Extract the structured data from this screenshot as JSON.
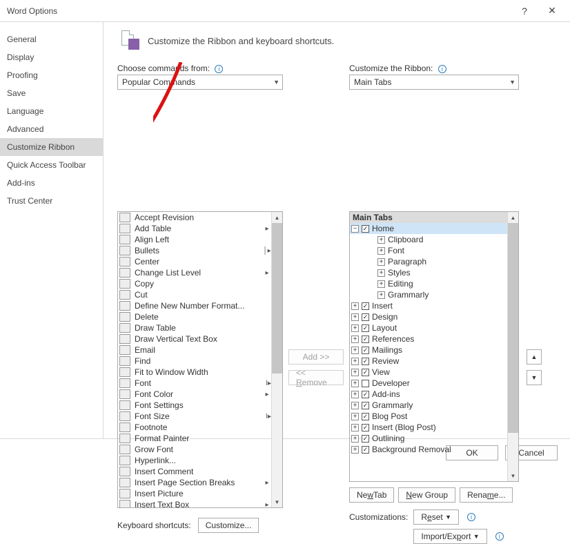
{
  "window": {
    "title": "Word Options"
  },
  "sidebar": {
    "items": [
      "General",
      "Display",
      "Proofing",
      "Save",
      "Language",
      "Advanced",
      "Customize Ribbon",
      "Quick Access Toolbar",
      "Add-ins",
      "Trust Center"
    ],
    "selected_index": 6
  },
  "heading": "Customize the Ribbon and keyboard shortcuts.",
  "choose_label": "Choose commands from:",
  "choose_value": "Popular Commands",
  "customize_label": "Customize the Ribbon:",
  "customize_value": "Main Tabs",
  "commands": [
    {
      "label": "Accept Revision"
    },
    {
      "label": "Add Table",
      "sub": true
    },
    {
      "label": "Align Left"
    },
    {
      "label": "Bullets",
      "sub": true,
      "split": true
    },
    {
      "label": "Center"
    },
    {
      "label": "Change List Level",
      "sub": true
    },
    {
      "label": "Copy"
    },
    {
      "label": "Cut"
    },
    {
      "label": "Define New Number Format..."
    },
    {
      "label": "Delete"
    },
    {
      "label": "Draw Table"
    },
    {
      "label": "Draw Vertical Text Box"
    },
    {
      "label": "Email"
    },
    {
      "label": "Find"
    },
    {
      "label": "Fit to Window Width"
    },
    {
      "label": "Font",
      "split": true,
      "editmark": true
    },
    {
      "label": "Font Color",
      "sub": true
    },
    {
      "label": "Font Settings"
    },
    {
      "label": "Font Size",
      "split": true,
      "editmark": true
    },
    {
      "label": "Footnote"
    },
    {
      "label": "Format Painter"
    },
    {
      "label": "Grow Font"
    },
    {
      "label": "Hyperlink..."
    },
    {
      "label": "Insert Comment"
    },
    {
      "label": "Insert Page  Section Breaks",
      "sub": true
    },
    {
      "label": "Insert Picture"
    },
    {
      "label": "Insert Text Box",
      "sub": true
    }
  ],
  "tree": {
    "header": "Main Tabs",
    "home": {
      "label": "Home",
      "children": [
        "Clipboard",
        "Font",
        "Paragraph",
        "Styles",
        "Editing",
        "Grammarly"
      ]
    },
    "tabs": [
      {
        "label": "Insert",
        "checked": true
      },
      {
        "label": "Design",
        "checked": true
      },
      {
        "label": "Layout",
        "checked": true
      },
      {
        "label": "References",
        "checked": true
      },
      {
        "label": "Mailings",
        "checked": true
      },
      {
        "label": "Review",
        "checked": true
      },
      {
        "label": "View",
        "checked": true
      },
      {
        "label": "Developer",
        "checked": false
      },
      {
        "label": "Add-ins",
        "checked": true
      },
      {
        "label": "Grammarly",
        "checked": true
      },
      {
        "label": "Blog Post",
        "checked": true
      },
      {
        "label": "Insert (Blog Post)",
        "checked": true
      },
      {
        "label": "Outlining",
        "checked": true
      },
      {
        "label": "Background Removal",
        "checked": true
      }
    ]
  },
  "buttons": {
    "add": "Add >>",
    "remove": "<< Remove",
    "new_tab": "New Tab",
    "new_group": "New Group",
    "rename": "Rename...",
    "customizations_label": "Customizations:",
    "reset": "Reset",
    "import_export": "Import/Export",
    "kb_label": "Keyboard shortcuts:",
    "kb_customize": "Customize...",
    "ok": "OK",
    "cancel": "Cancel"
  }
}
